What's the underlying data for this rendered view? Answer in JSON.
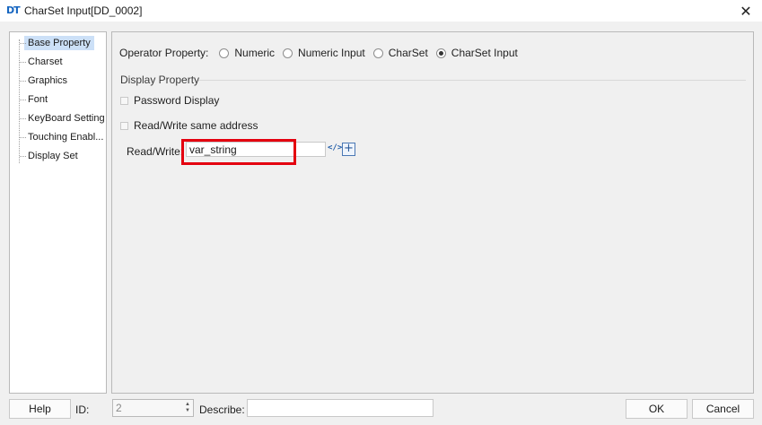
{
  "window": {
    "logo_text": "DT",
    "title": "CharSet Input[DD_0002]",
    "close_glyph": "✕"
  },
  "tree": {
    "items": [
      {
        "label": "Base Property",
        "selected": true
      },
      {
        "label": "Charset"
      },
      {
        "label": "Graphics"
      },
      {
        "label": "Font"
      },
      {
        "label": "KeyBoard Setting"
      },
      {
        "label": "Touching Enabl..."
      },
      {
        "label": "Display Set"
      }
    ]
  },
  "operator": {
    "label": "Operator Property:",
    "options": [
      "Numeric",
      "Numeric Input",
      "CharSet",
      "CharSet Input"
    ],
    "selected": "CharSet Input"
  },
  "display": {
    "group_title": "Display Property",
    "password_label": "Password Display",
    "same_address_label": "Read/Write same address"
  },
  "readwrite": {
    "label": "Read/Write:",
    "value": "var_string",
    "code_icon_text": "</>",
    "plus_text": "+"
  },
  "footer": {
    "help_label": "Help",
    "id_label": "ID:",
    "id_value": "2",
    "describe_label": "Describe:",
    "ok_label": "OK",
    "cancel_label": "Cancel"
  },
  "colors": {
    "highlight": "#e4000f",
    "selection": "#cce0f7"
  }
}
